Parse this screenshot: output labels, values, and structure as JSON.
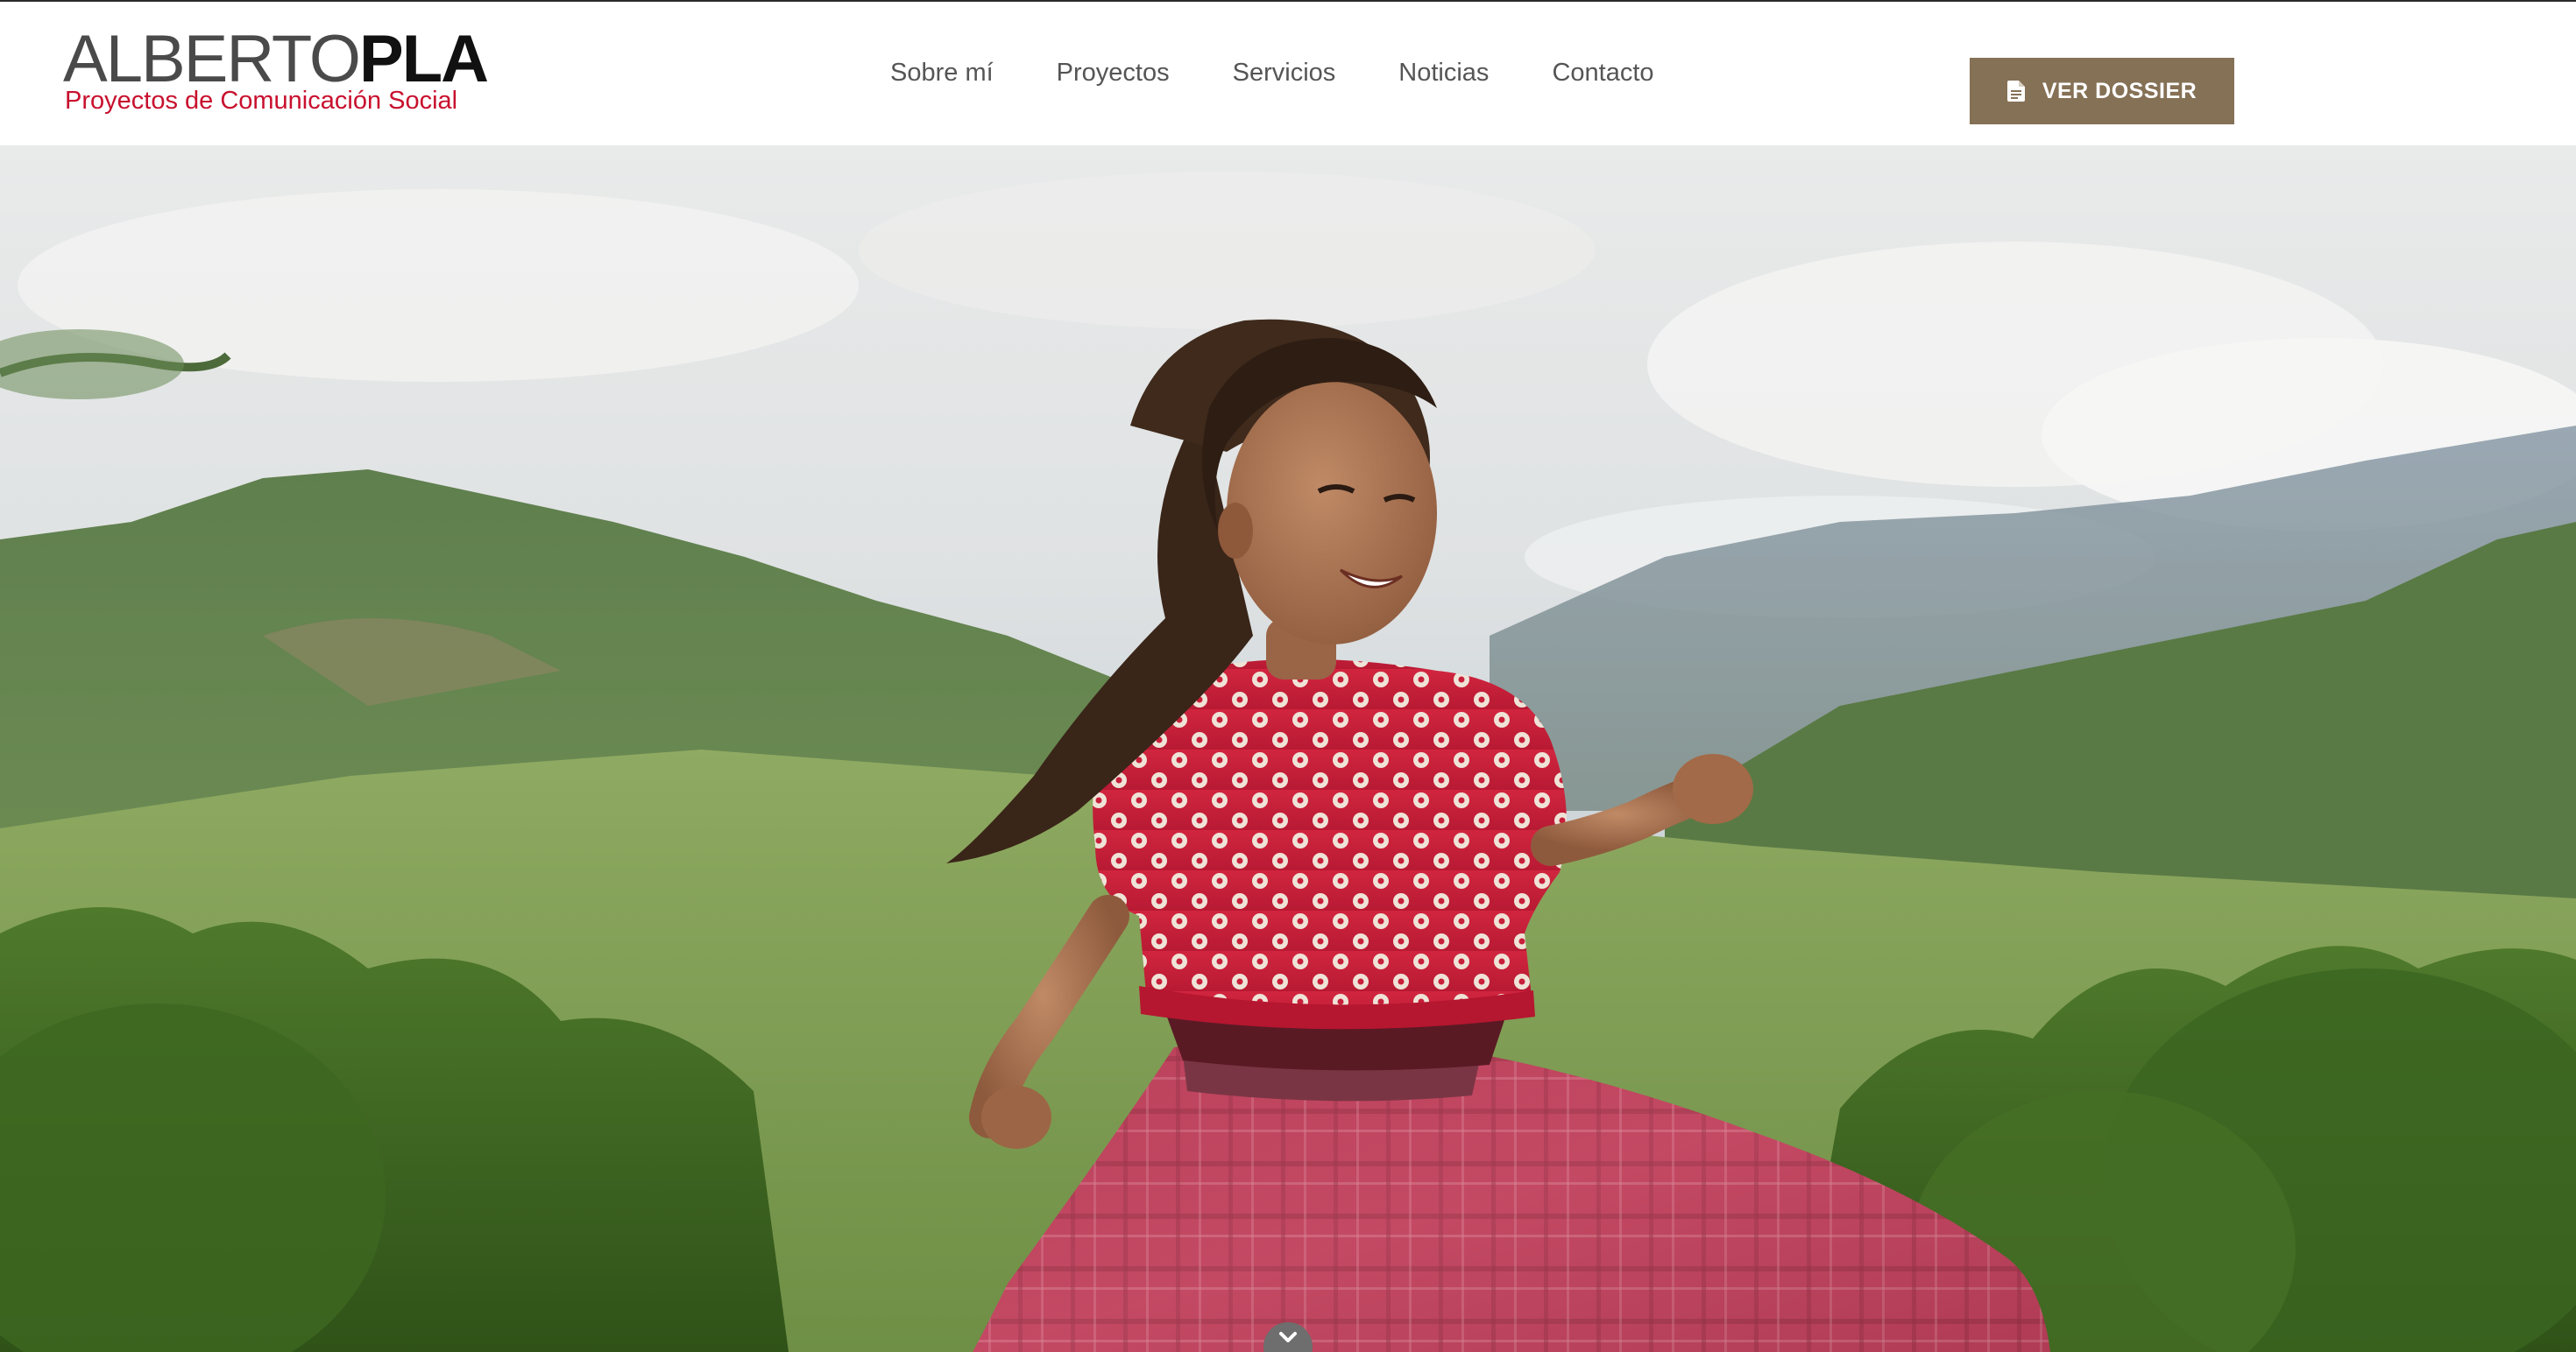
{
  "brand": {
    "name_first": "ALBERTO",
    "name_last": "PLA",
    "tagline": "Proyectos de Comunicación Social",
    "accent_color": "#c8102e"
  },
  "nav": {
    "items": [
      {
        "label": "Sobre mí"
      },
      {
        "label": "Proyectos"
      },
      {
        "label": "Servicios"
      },
      {
        "label": "Noticias"
      },
      {
        "label": "Contacto"
      }
    ]
  },
  "cta": {
    "label": "VER DOSSIER",
    "icon": "document-icon",
    "background": "#857156"
  },
  "hero": {
    "image": "photo-girl-spinning-in-red-skirt-mountains",
    "scroll_icon": "chevron-down-icon"
  }
}
